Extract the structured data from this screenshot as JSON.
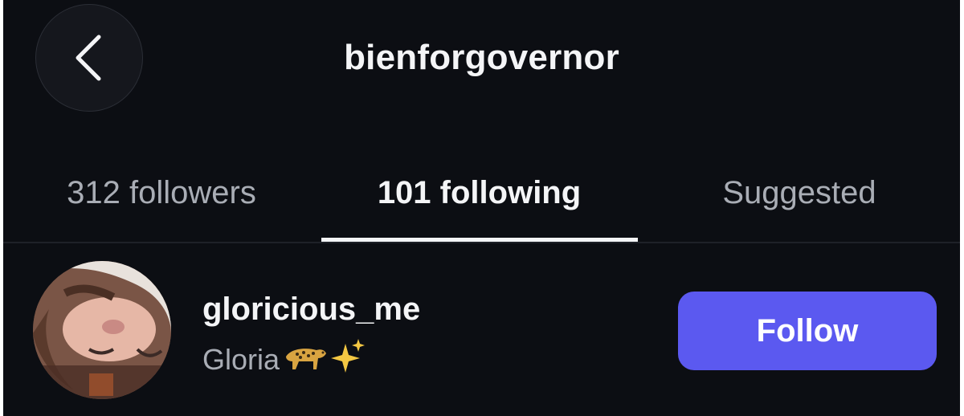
{
  "header": {
    "title": "bienforgovernor",
    "back_icon": "chevron-left-icon"
  },
  "tabs": [
    {
      "label": "312 followers",
      "active": false
    },
    {
      "label": "101 following",
      "active": true
    },
    {
      "label": "Suggested",
      "active": false
    }
  ],
  "list": [
    {
      "username": "gloricious_me",
      "full_name": "Gloria",
      "name_emojis": [
        "leopard-emoji",
        "sparkles-emoji"
      ],
      "button_label": "Follow"
    }
  ],
  "colors": {
    "background": "#0c0e13",
    "accent": "#5b59f0",
    "text_primary": "#f4f5f7",
    "text_secondary": "#a9adb5"
  }
}
